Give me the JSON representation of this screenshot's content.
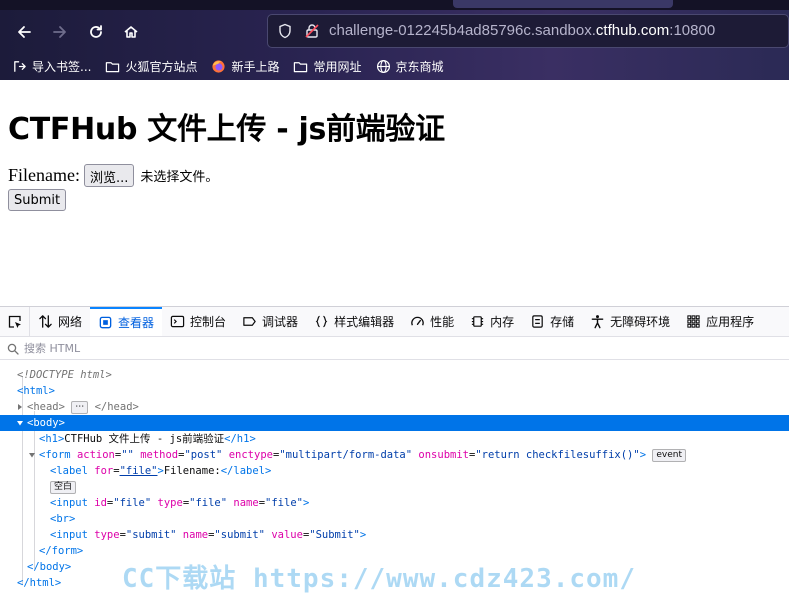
{
  "browser": {
    "url_prefix": "challenge-012245b4ad85796c.sandbox.",
    "url_host": "ctfhub.com",
    "url_port": ":10800",
    "bookmarks": [
      {
        "label": "导入书签...",
        "icon": "import-icon"
      },
      {
        "label": "火狐官方站点",
        "icon": "folder-icon"
      },
      {
        "label": "新手上路",
        "icon": "firefox-icon"
      },
      {
        "label": "常用网址",
        "icon": "folder-icon"
      },
      {
        "label": "京东商城",
        "icon": "globe-icon"
      }
    ]
  },
  "page": {
    "title": "CTFHub 文件上传 - js前端验证",
    "filename_label": "Filename:",
    "browse_label": "浏览...",
    "no_file_text": "未选择文件。",
    "submit_label": "Submit"
  },
  "devtools": {
    "tabs": [
      {
        "label": "网络",
        "icon": "network-icon"
      },
      {
        "label": "查看器",
        "icon": "inspector-icon",
        "active": true
      },
      {
        "label": "控制台",
        "icon": "console-icon"
      },
      {
        "label": "调试器",
        "icon": "debugger-icon"
      },
      {
        "label": "样式编辑器",
        "icon": "braces-icon"
      },
      {
        "label": "性能",
        "icon": "gauge-icon"
      },
      {
        "label": "内存",
        "icon": "memory-icon"
      },
      {
        "label": "存储",
        "icon": "storage-icon"
      },
      {
        "label": "无障碍环境",
        "icon": "accessibility-icon"
      },
      {
        "label": "应用程序",
        "icon": "grid-icon"
      }
    ],
    "search_placeholder": "搜索 HTML",
    "tree": {
      "doctype": "<!DOCTYPE html>",
      "h1_text": "CTFHub 文件上传 - js前端验证",
      "form_action": "\"\"",
      "form_method": "\"post\"",
      "form_enctype": "\"multipart/form-data\"",
      "form_onsubmit": "\"return checkfilesuffix()\"",
      "event_badge": "event",
      "label_for": "\"file\"",
      "label_text": "Filename:",
      "whitespace_badge": "空白",
      "input_id": "\"file\"",
      "input_type": "\"file\"",
      "input_name": "\"file\"",
      "submit_type": "\"submit\"",
      "submit_name": "\"submit\"",
      "submit_value": "\"Submit\""
    }
  },
  "watermark": "CC下载站 https://www.cdz423.com/"
}
